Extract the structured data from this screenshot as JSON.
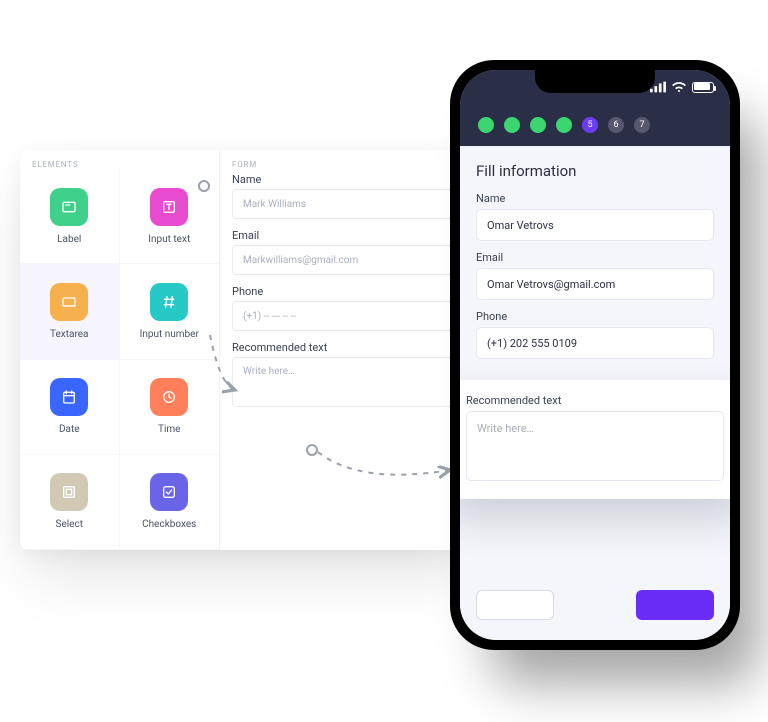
{
  "palette": {
    "heading": "ELEMENTS",
    "items": [
      {
        "label": "Label",
        "color": "#3fd08a",
        "icon": "label"
      },
      {
        "label": "Input text",
        "color": "#e84bcf",
        "icon": "text"
      },
      {
        "label": "Textarea",
        "color": "#f6b04e",
        "icon": "textarea",
        "selected": true
      },
      {
        "label": "Input number",
        "color": "#27c9c6",
        "icon": "number"
      },
      {
        "label": "Date",
        "color": "#3a66ff",
        "icon": "date"
      },
      {
        "label": "Time",
        "color": "#ff805a",
        "icon": "time"
      },
      {
        "label": "Select",
        "color": "#d1c9b4",
        "icon": "select"
      },
      {
        "label": "Checkboxes",
        "color": "#6a64e8",
        "icon": "check"
      }
    ]
  },
  "form_builder": {
    "heading": "FORM",
    "close": "×",
    "fields": {
      "name": {
        "label": "Name",
        "value": "Mark Williams"
      },
      "email": {
        "label": "Email",
        "value": "Markwilliams@gmail.com"
      },
      "phone": {
        "label": "Phone",
        "value": "(+1) -- --- -- --"
      },
      "rec": {
        "label": "Recommended text",
        "value": "Write here…"
      }
    }
  },
  "phone": {
    "steps": [
      {
        "kind": "done"
      },
      {
        "kind": "done"
      },
      {
        "kind": "done"
      },
      {
        "kind": "done"
      },
      {
        "kind": "current",
        "n": "5"
      },
      {
        "kind": "todo",
        "n": "6"
      },
      {
        "kind": "todo",
        "n": "7"
      }
    ],
    "title": "Fill information",
    "fields": {
      "name": {
        "label": "Name",
        "value": "Omar Vetrovs"
      },
      "email": {
        "label": "Email",
        "value": "Omar Vetrovs@gmail.com"
      },
      "phone": {
        "label": "Phone",
        "value": "(+1) 202 555 0109"
      },
      "rec": {
        "label": "Recommended text",
        "value": "Write here…"
      }
    }
  }
}
